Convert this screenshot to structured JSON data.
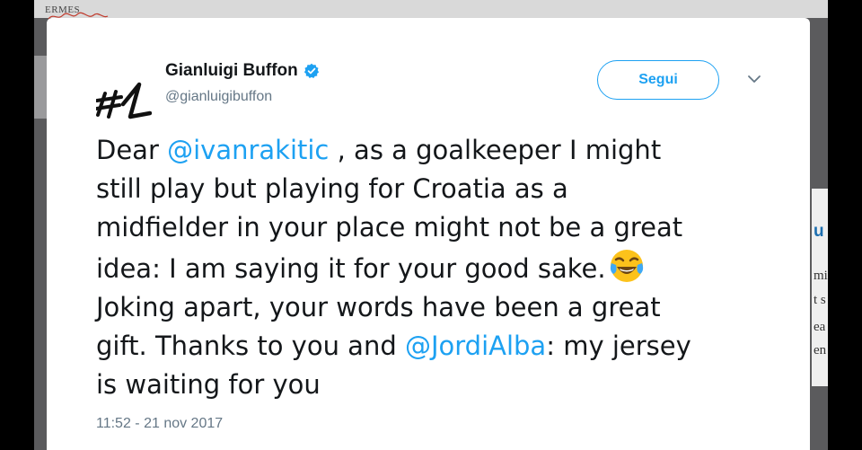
{
  "watermark": "ERMES",
  "background": {
    "side_texts": [
      "u",
      "mi",
      "t s",
      "ea",
      "en"
    ]
  },
  "tweet": {
    "author": {
      "name": "Gianluigi Buffon",
      "handle": "@gianluigibuffon",
      "verified": true,
      "avatar_icon": "number-one-signature-logo"
    },
    "follow_label": "Segui",
    "text_segments": [
      {
        "t": "Dear "
      },
      {
        "t": "@ivanrakitic",
        "mention": true
      },
      {
        "t": " , as a goalkeeper I might"
      },
      {
        "t": "still play but playing for Croatia as a"
      },
      {
        "t": "midfielder in your place might not be a great"
      },
      {
        "t": "idea: I am saying it for your good sake."
      },
      {
        "t": "Joking apart, your words have been a great"
      },
      {
        "t": "gift. Thanks to you and "
      },
      {
        "t": "@JordiAlba",
        "mention": true
      },
      {
        "t": ": my jersey"
      },
      {
        "t": "is waiting for you"
      }
    ],
    "emoji": "face-with-tears-of-joy-emoji",
    "timestamp": "11:52 - 21 nov 2017"
  },
  "colors": {
    "accent": "#1da1f2",
    "text": "#14171a",
    "secondary": "#657786"
  }
}
